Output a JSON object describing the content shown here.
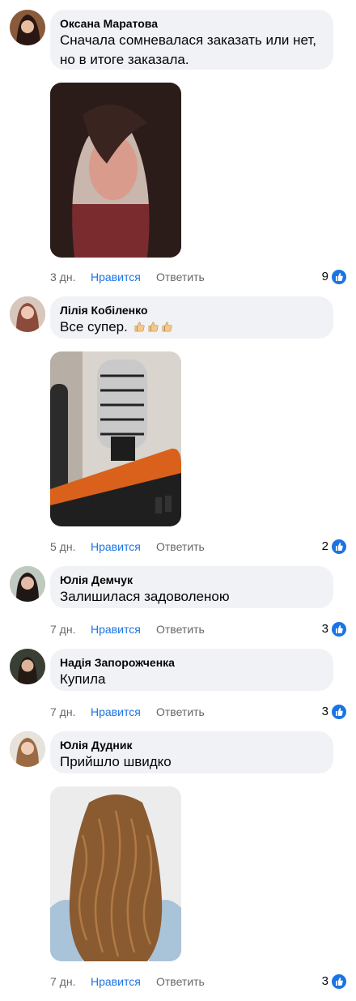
{
  "comments": [
    {
      "author": "Оксана Маратова",
      "text": "Сначала сомневалася заказать или нет, но в итоге заказала.",
      "has_photo": true,
      "time": "3 дн.",
      "like_label": "Нравится",
      "reply_label": "Ответить",
      "reactions": "9"
    },
    {
      "author": "Лілія Кобіленко",
      "text": "Все супер.",
      "emojis": [
        "thumbs-up",
        "thumbs-up",
        "thumbs-up"
      ],
      "has_photo": true,
      "time": "5 дн.",
      "like_label": "Нравится",
      "reply_label": "Ответить",
      "reactions": "2"
    },
    {
      "author": "Юлія Демчук",
      "text": "Залишилася задоволеною",
      "has_photo": false,
      "time": "7 дн.",
      "like_label": "Нравится",
      "reply_label": "Ответить",
      "reactions": "3"
    },
    {
      "author": "Надія Запорожченка",
      "text": "Купила",
      "has_photo": false,
      "time": "7 дн.",
      "like_label": "Нравится",
      "reply_label": "Ответить",
      "reactions": "3"
    },
    {
      "author": "Юлія Дудник",
      "text": "Прийшло швидко",
      "has_photo": true,
      "time": "7 дн.",
      "like_label": "Нравится",
      "reply_label": "Ответить",
      "reactions": "3"
    }
  ],
  "colors": {
    "bubble": "#f0f2f5",
    "like_blue": "#1b74e4",
    "meta_gray": "#65676b"
  }
}
